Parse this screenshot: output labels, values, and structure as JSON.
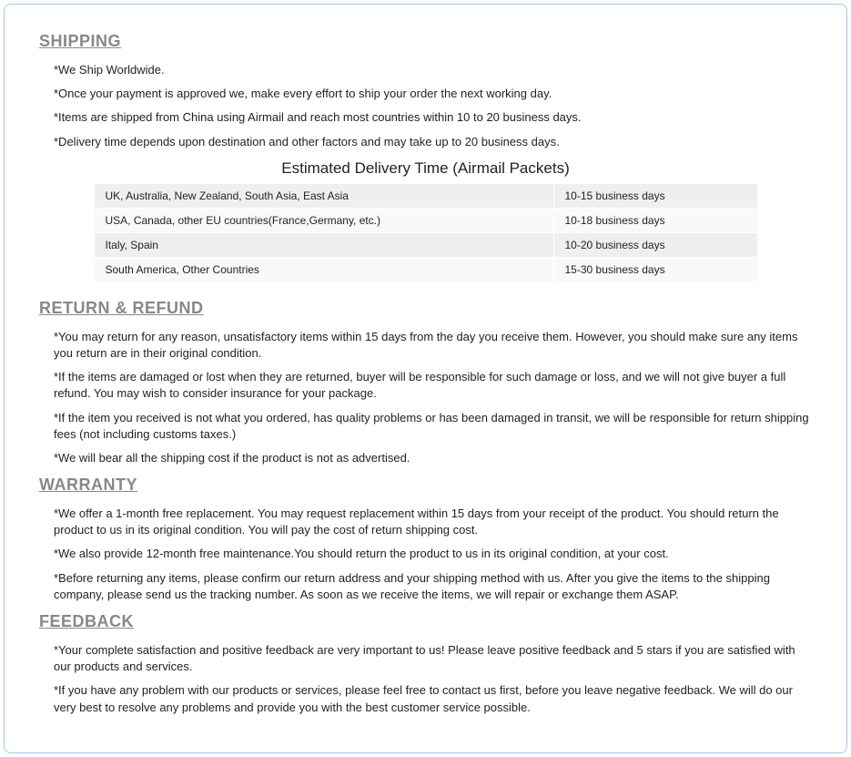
{
  "shipping": {
    "heading": "SHIPPING",
    "bullets": [
      "*We Ship Worldwide.",
      "*Once your payment is approved we, make every effort to ship your order the next working day.",
      "*Items are shipped from China using Airmail and reach most countries within 10 to 20 business days.",
      "*Delivery time depends upon destination and other factors and may take up to 20 business days."
    ],
    "table_caption": "Estimated Delivery Time (Airmail Packets)",
    "table": [
      {
        "region": "UK, Australia, New Zealand, South Asia, East Asia",
        "time": "10-15 business days"
      },
      {
        "region": "USA, Canada, other EU countries(France,Germany, etc.)",
        "time": "10-18 business days"
      },
      {
        "region": "Italy, Spain",
        "time": "10-20 business days"
      },
      {
        "region": "South America, Other Countries",
        "time": "15-30 business days"
      }
    ]
  },
  "return_refund": {
    "heading": "RETURN & REFUND",
    "bullets": [
      "*You may return for any reason, unsatisfactory items within 15 days from the day you receive them. However, you should make sure any items you return are in their original condition.",
      "*If the items are damaged or lost when they are returned, buyer will be responsible for such damage or loss, and we will not give buyer a full refund. You may wish to consider insurance for your package.",
      "*If the item you received is not what you ordered, has quality problems or has been damaged in transit, we will be responsible for return shipping fees (not including customs taxes.)",
      "*We will bear all the shipping cost if the product is not as advertised."
    ]
  },
  "warranty": {
    "heading": "WARRANTY",
    "bullets": [
      "*We offer a 1-month free replacement.  You may request replacement within 15 days from your receipt of the product. You should return the product to us in its original condition. You will pay the cost of return shipping cost.",
      "*We also provide 12-month free maintenance.You should return the product to us in its original condition, at your cost.",
      "*Before returning any items, please confirm our return address and your shipping method with us. After you give the items to the shipping company, please send us the tracking number. As soon as we receive the items, we will repair or exchange them ASAP."
    ]
  },
  "feedback": {
    "heading": "FEEDBACK",
    "bullets": [
      "*Your complete satisfaction and positive feedback are very important to us!  Please leave positive feedback and 5 stars if you are satisfied with our products and services.",
      "*If you have any problem with our products or services, please feel free to contact us first, before you leave negative feedback.  We will do our very best to resolve any problems and provide you with the best customer service possible."
    ]
  }
}
